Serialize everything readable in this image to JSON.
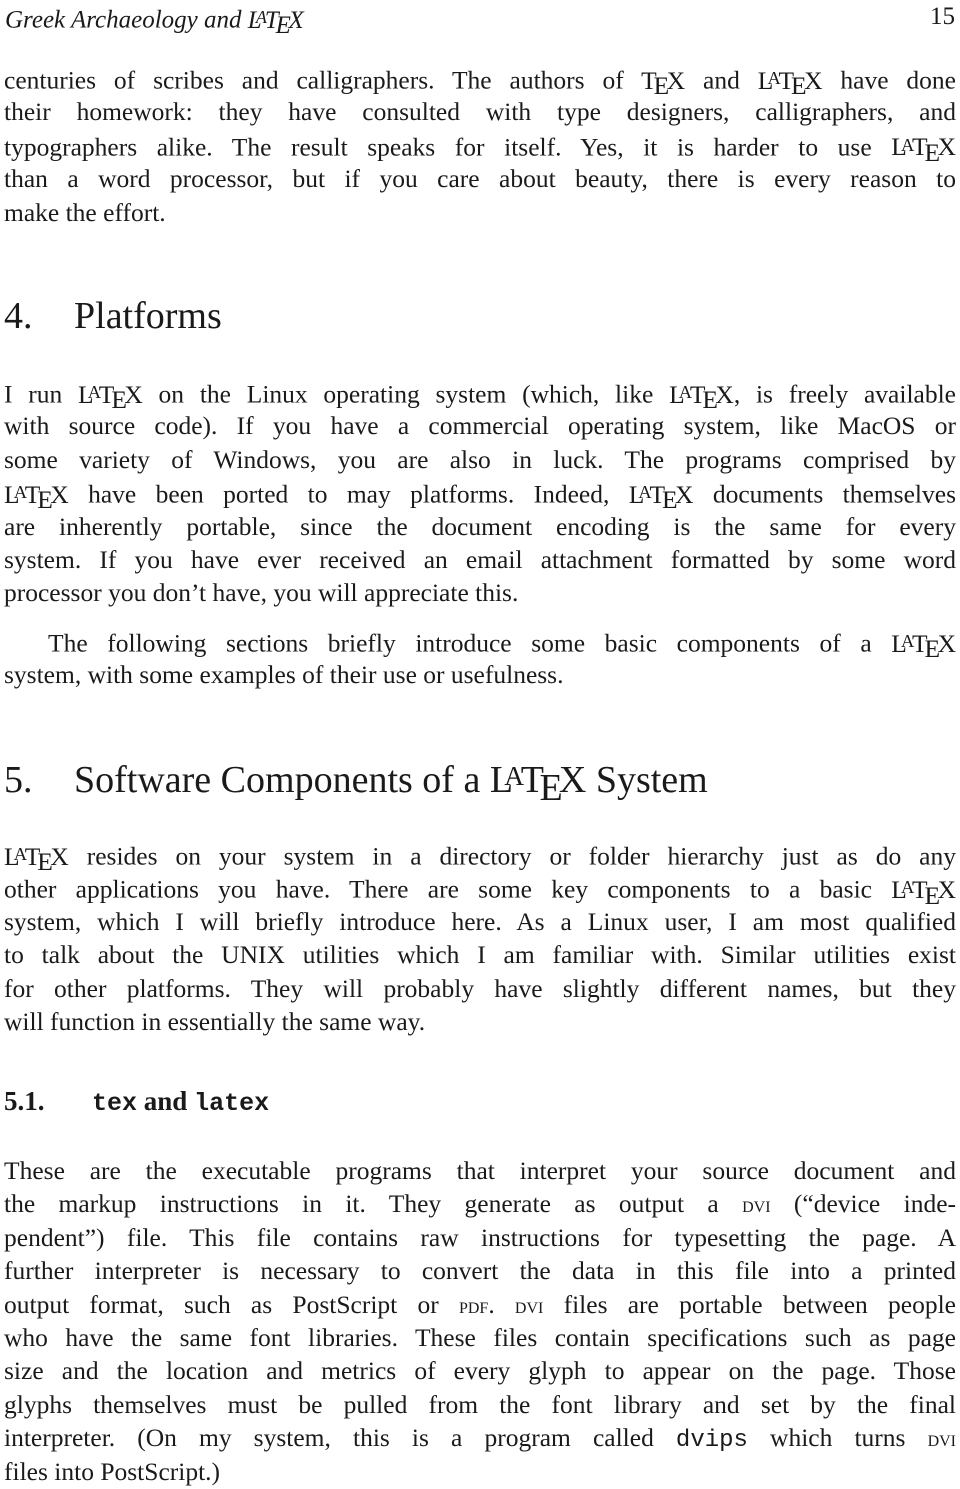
{
  "header": {
    "running_title": "Greek Archaeology and",
    "running_title_latex": "LaTeX",
    "page_number": "15"
  },
  "latex": {
    "L": "L",
    "A": "A",
    "T": "T",
    "E": "E",
    "X": "X"
  },
  "paragraph_intro": [
    "centuries of scribes and calligraphers. The authors of TEX and LATEX have done",
    "their homework: they have consulted with type designers, calligraphers, and",
    "typographers alike. The result speaks for itself. Yes, it is harder to use LATEX",
    "than a word processor, but if you care about beauty, there is every reason to",
    "make the effort."
  ],
  "section4": {
    "number": "4.",
    "title": "Platforms",
    "para1": {
      "l1a": "I run ",
      "l1b": " on the Linux operating system (which, like ",
      "l1c": ", is freely available",
      "l2": "with source code). If you have a commercial operating system, like MacOS or",
      "l3": "some variety of Windows, you are also in luck. The programs comprised by",
      "l4a": " have been ported to may platforms. Indeed, ",
      "l4b": " documents themselves",
      "l5": "are inherently portable, since the document encoding is the same for every",
      "l6": "system. If you have ever received an email attachment formatted by some word",
      "l7": "processor you don’t have, you will appreciate this."
    },
    "para2": {
      "l1": "The following sections briefly introduce some basic components of a ",
      "l2": "system, with some examples of their use or usefulness."
    }
  },
  "section5": {
    "number": "5.",
    "title_a": "Software Components of a ",
    "title_b": " System",
    "para1": {
      "l1": " resides on your system in a directory or folder hierarchy just as do any",
      "l2": "other applications you have. There are some key components to a basic ",
      "l3": "system, which I will briefly introduce here. As a Linux user, I am most qualified",
      "l4": "to talk about the UNIX utilities which I am familiar with. Similar utilities exist",
      "l5": "for other platforms. They will probably have slightly different names, but they",
      "l6": "will function in essentially the same way."
    }
  },
  "section5_1": {
    "number": "5.1.",
    "code_a": "tex",
    "and": " and ",
    "code_b": "latex",
    "para1": {
      "l1": "These are the executable programs that interpret your source document and",
      "l2a": "the markup instructions in it. They generate as output a ",
      "l2_dvi": "dvi",
      "l2b": " (“device inde-",
      "l3": "pendent”) file. This file contains raw instructions for typesetting the page. A",
      "l4": "further interpreter is necessary to convert the data in this file into a printed",
      "l5a": "output format, such as PostScript or ",
      "l5_pdf": "pdf",
      "l5_dot": ". ",
      "l5_dvi": "dvi",
      "l5b": " files are portable between people",
      "l6": "who have the same font libraries. These files contain specifications such as page",
      "l7": "size and the location and metrics of every glyph to appear on the page. Those",
      "l8": "glyphs themselves must be pulled from the font library and set by the final",
      "l9a": "interpreter. (On my system, this is a program called ",
      "l9_code": "dvips",
      "l9b": " which turns ",
      "l9_dvi": "dvi",
      "l10": "files into PostScript.)"
    }
  }
}
